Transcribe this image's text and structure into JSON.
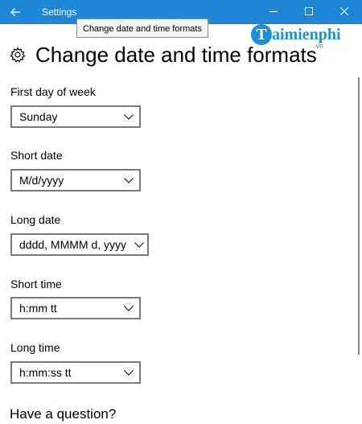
{
  "window": {
    "app_title": "Settings",
    "accent_color": "#1f86d6"
  },
  "tooltip": {
    "text": "Change date and time formats"
  },
  "watermark": {
    "mark": "T",
    "name": "aimienphi",
    "suffix": ".vn",
    "color": "#1a8fdc"
  },
  "page": {
    "title": "Change date and time formats",
    "icon": "gear-icon"
  },
  "fields": [
    {
      "label": "First day of week",
      "value": "Sunday"
    },
    {
      "label": "Short date",
      "value": "M/d/yyyy"
    },
    {
      "label": "Long date",
      "value": "dddd, MMMM d, yyyy"
    },
    {
      "label": "Short time",
      "value": "h:mm tt"
    },
    {
      "label": "Long time",
      "value": "h:mm:ss tt"
    }
  ],
  "help": {
    "heading": "Have a question?"
  }
}
